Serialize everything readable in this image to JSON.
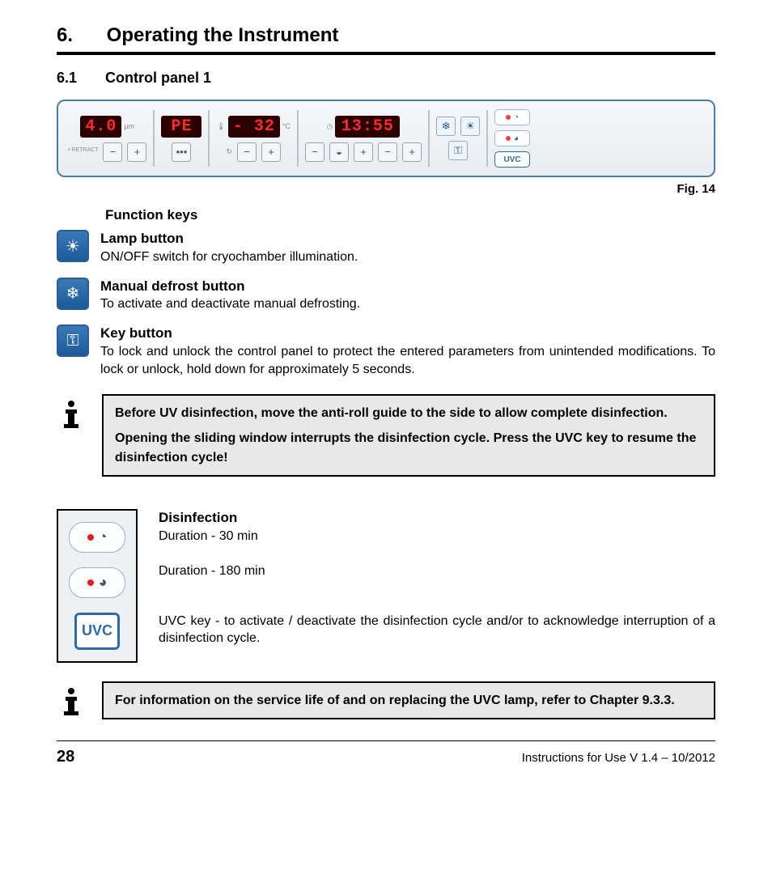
{
  "header": {
    "num": "6.",
    "title": "Operating the Instrument"
  },
  "sub": {
    "num": "6.1",
    "title": "Control panel 1"
  },
  "panel": {
    "thickness": "4.0",
    "thickness_unit": "µm",
    "retract": "• RETRACT",
    "status": "PE",
    "temp": "- 32",
    "temp_unit": "°C",
    "time": "13:55"
  },
  "buttons": {
    "minus": "−",
    "plus": "+",
    "dots": "•••"
  },
  "fig": "Fig. 14",
  "fk_title": "Function keys",
  "fk": [
    {
      "name": "lamp",
      "title": "Lamp button",
      "desc": "ON/OFF switch for cryochamber illumination."
    },
    {
      "name": "defrost",
      "title": "Manual defrost button",
      "desc": "To activate and deactivate manual defrosting."
    },
    {
      "name": "key",
      "title": "Key button",
      "desc": "To lock and unlock the control panel to protect the entered parameters from unintended modifications. To lock or unlock, hold down for approximately 5 seconds."
    }
  ],
  "info1": {
    "p1": "Before UV disinfection, move the anti-roll guide to the side to allow complete disinfection.",
    "p2": "Opening the sliding window interrupts the disinfection cycle. Press the UVC key to resume the disinfection cycle!"
  },
  "dis": {
    "title": "Disinfection",
    "d30": "Duration - 30 min",
    "d180": "Duration - 180 min",
    "uvc": "UVC key - to activate / deactivate the disinfection cycle and/or to acknowledge interruption of a disinfection cycle.",
    "uvc_label": "UVC"
  },
  "info2": "For information on the service life of and on replacing the UVC lamp, refer to Chapter 9.3.3.",
  "footer": {
    "page": "28",
    "version": "Instructions for Use V 1.4 – 10/2012"
  }
}
